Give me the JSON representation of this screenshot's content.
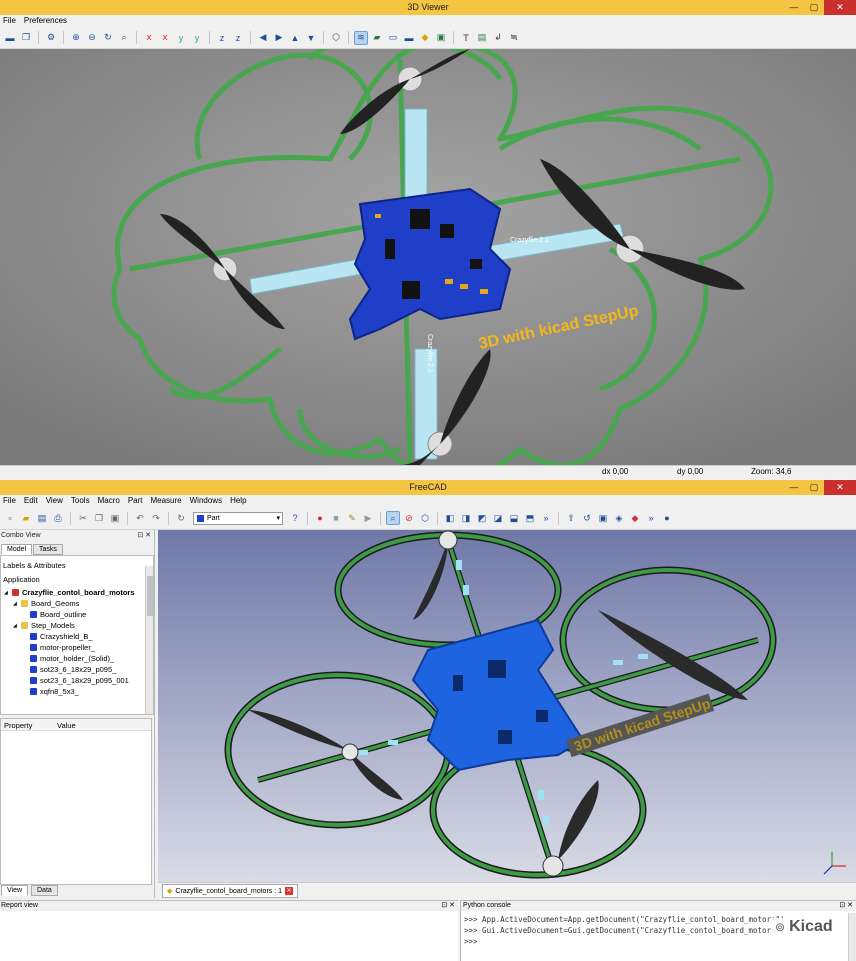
{
  "viewer": {
    "title": "3D Viewer",
    "menu": [
      "File",
      "Preferences"
    ],
    "status": {
      "dx": "dx 0,00",
      "dy": "dy 0,00",
      "zoom": "Zoom: 34,6"
    },
    "overlay_text": "3D with kicad StepUp",
    "board_labels": [
      "Crazyflie 2.1",
      "Crazyflie 2.1"
    ]
  },
  "freecad": {
    "title": "FreeCAD",
    "menu": [
      "File",
      "Edit",
      "View",
      "Tools",
      "Macro",
      "Part",
      "Measure",
      "Windows",
      "Help"
    ],
    "workbench": "Part",
    "combo_view": {
      "title": "Combo View",
      "tabs": [
        "Model",
        "Tasks"
      ],
      "labels_header": "Labels & Attributes",
      "application": "Application",
      "tree": [
        {
          "label": "Crazyflie_contol_board_motors",
          "level": 0,
          "kind": "doc"
        },
        {
          "label": "Board_Geoms",
          "level": 1,
          "kind": "folder"
        },
        {
          "label": "Board_outline",
          "level": 2,
          "kind": "part"
        },
        {
          "label": "Step_Models",
          "level": 1,
          "kind": "folder"
        },
        {
          "label": "Crazyshield_B_",
          "level": 2,
          "kind": "part"
        },
        {
          "label": "motor-propeller_",
          "level": 2,
          "kind": "part"
        },
        {
          "label": "motor_holder_(Solid)_",
          "level": 2,
          "kind": "part"
        },
        {
          "label": "sot23_6_18x29_p095_",
          "level": 2,
          "kind": "part"
        },
        {
          "label": "sot23_6_18x29_p095_001",
          "level": 2,
          "kind": "part"
        },
        {
          "label": "xqfn8_5x3_",
          "level": 2,
          "kind": "part"
        }
      ],
      "property_headers": [
        "Property",
        "Value"
      ],
      "bottom_tabs": [
        "View",
        "Data"
      ]
    },
    "doc_tab": "Crazyflie_contol_board_motors : 1",
    "overlay_text": "3D with kicad StepUp",
    "report_view": "Report view",
    "python_console": {
      "title": "Python console",
      "lines": [
        ">>> App.ActiveDocument=App.getDocument(\"Crazyflie_contol_board_motors\")",
        ">>> Gui.ActiveDocument=Gui.getDocument(\"Crazyflie_contol_board_motors\")",
        ">>>"
      ]
    },
    "watermark": "Kicad"
  },
  "colors": {
    "title_bar": "#f4c542",
    "viewer_bg": "#8d8d8d",
    "frame_green": "#47a64e",
    "pcb_blue_viewer": "#1f3fc9",
    "pcb_blue_freecad": "#1e63e0",
    "overlay_text_viewer": "#f2b81a",
    "fc_bg_top": "#6f78a8",
    "fc_bg_bottom": "#d9dbe6"
  }
}
